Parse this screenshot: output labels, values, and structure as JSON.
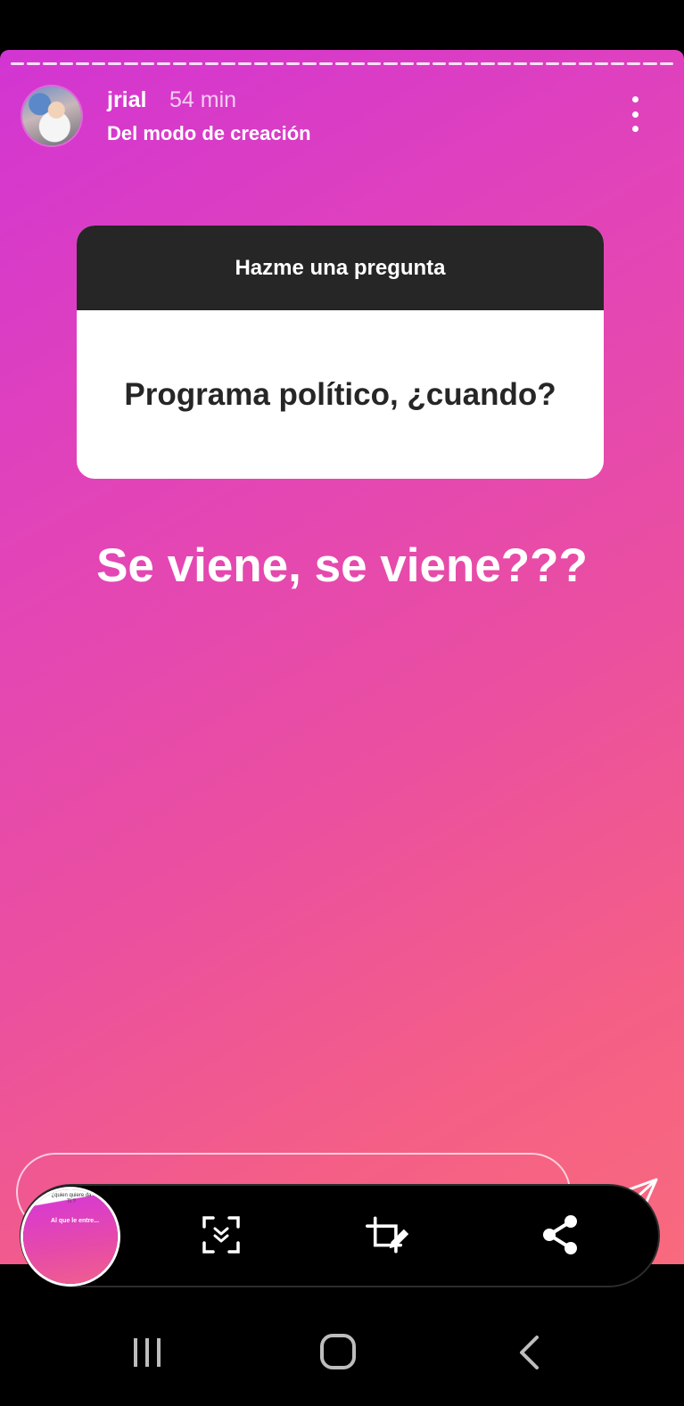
{
  "story": {
    "username": "jrial",
    "time": "54 min",
    "subtitle": "Del modo de creación",
    "segments": 41
  },
  "question_sticker": {
    "header": "Hazme una pregunta",
    "question": "Programa político, ¿cuando?"
  },
  "caption": "Se viene, se viene???",
  "thumbnail": {
    "question_text": "¿quien quiere da Ti ?",
    "answer_text": "Al que le entre..."
  },
  "toolbar": {
    "items": [
      "thumbnail",
      "scan-icon",
      "crop-edit-icon",
      "share-icon"
    ]
  },
  "navbar": {
    "items": [
      "recent-apps-icon",
      "home-icon",
      "back-icon"
    ]
  },
  "colors": {
    "gradient_start": "#d235d2",
    "gradient_end": "#f86a7e",
    "sticker_header": "#262626"
  }
}
